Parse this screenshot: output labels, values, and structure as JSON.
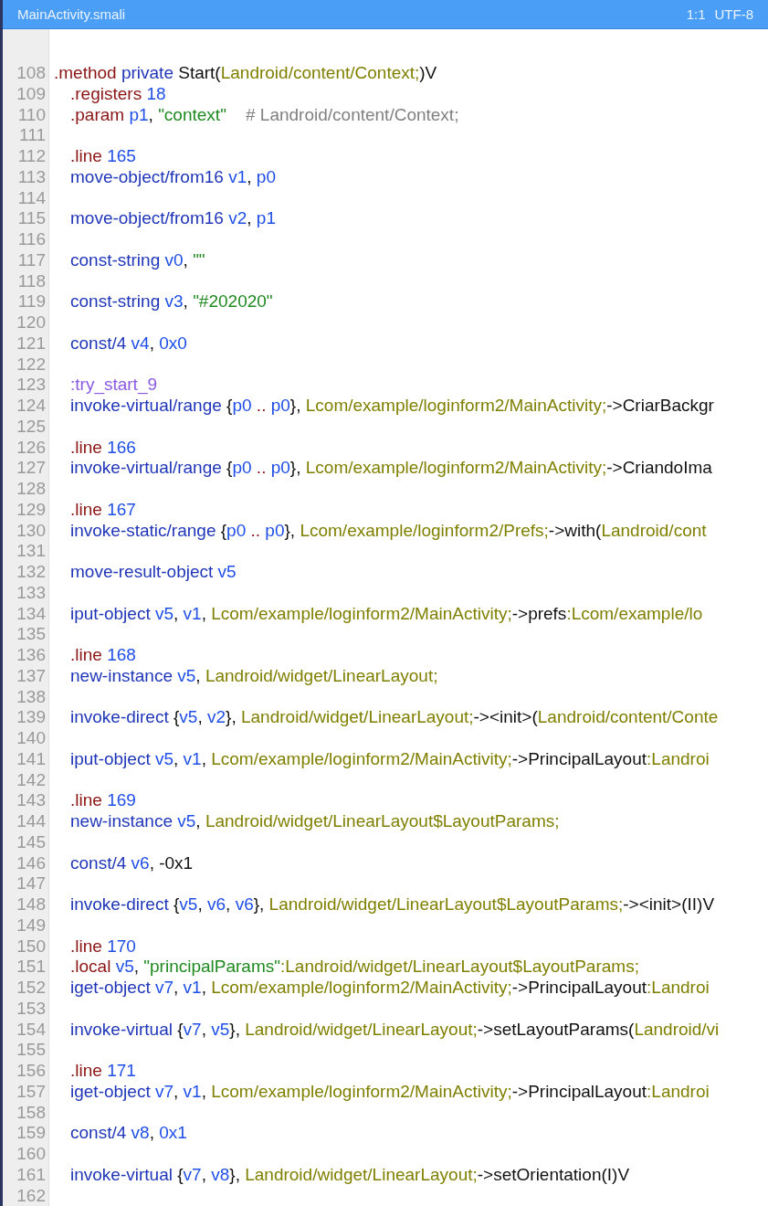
{
  "editor": {
    "file_name": "MainActivity.smali",
    "cursor_position": "1:1",
    "encoding": "UTF-8"
  },
  "lines": [
    {
      "number": "108",
      "kind": "header",
      "tokens": [
        {
          "text": ".method ",
          "kind": "directive"
        },
        {
          "text": "private",
          "kind": "op"
        },
        {
          "text": " Start(",
          "kind": "plain"
        },
        {
          "text": "Landroid/content/Context;",
          "kind": "type"
        },
        {
          "text": ")V",
          "kind": "plain"
        }
      ]
    },
    {
      "number": "109",
      "kind": "body",
      "tokens": [
        {
          "text": ".registers ",
          "kind": "directive"
        },
        {
          "text": "18",
          "kind": "number"
        }
      ]
    },
    {
      "number": "110",
      "kind": "body",
      "tokens": [
        {
          "text": ".param ",
          "kind": "directive"
        },
        {
          "text": "p1",
          "kind": "register"
        },
        {
          "text": ", ",
          "kind": "plain"
        },
        {
          "text": "\"context\"",
          "kind": "string"
        },
        {
          "text": "    # Landroid/content/Context;",
          "kind": "comment"
        }
      ]
    },
    {
      "number": "111"
    },
    {
      "number": "112",
      "kind": "body",
      "tokens": [
        {
          "text": ".line ",
          "kind": "directive"
        },
        {
          "text": "165",
          "kind": "number"
        }
      ]
    },
    {
      "number": "113",
      "kind": "body",
      "tokens": [
        {
          "text": "move-object/from16 ",
          "kind": "op"
        },
        {
          "text": "v1",
          "kind": "register"
        },
        {
          "text": ", ",
          "kind": "plain"
        },
        {
          "text": "p0",
          "kind": "register"
        }
      ]
    },
    {
      "number": "114"
    },
    {
      "number": "115",
      "kind": "body",
      "tokens": [
        {
          "text": "move-object/from16 ",
          "kind": "op"
        },
        {
          "text": "v2",
          "kind": "register"
        },
        {
          "text": ", ",
          "kind": "plain"
        },
        {
          "text": "p1",
          "kind": "register"
        }
      ]
    },
    {
      "number": "116"
    },
    {
      "number": "117",
      "kind": "body",
      "tokens": [
        {
          "text": "const-string ",
          "kind": "op"
        },
        {
          "text": "v0",
          "kind": "register"
        },
        {
          "text": ", ",
          "kind": "plain"
        },
        {
          "text": "\"\"",
          "kind": "string"
        }
      ]
    },
    {
      "number": "118"
    },
    {
      "number": "119",
      "kind": "body",
      "tokens": [
        {
          "text": "const-string ",
          "kind": "op"
        },
        {
          "text": "v3",
          "kind": "register"
        },
        {
          "text": ", ",
          "kind": "plain"
        },
        {
          "text": "\"#202020\"",
          "kind": "string"
        }
      ]
    },
    {
      "number": "120"
    },
    {
      "number": "121",
      "kind": "body",
      "tokens": [
        {
          "text": "const/4 ",
          "kind": "op"
        },
        {
          "text": "v4",
          "kind": "register"
        },
        {
          "text": ", ",
          "kind": "plain"
        },
        {
          "text": "0x0",
          "kind": "number"
        }
      ]
    },
    {
      "number": "122"
    },
    {
      "number": "123",
      "kind": "body",
      "tokens": [
        {
          "text": ":try_start_9",
          "kind": "label"
        }
      ]
    },
    {
      "number": "124",
      "kind": "body",
      "tokens": [
        {
          "text": "invoke-virtual/range",
          "kind": "op"
        },
        {
          "text": " {",
          "kind": "plain"
        },
        {
          "text": "p0",
          "kind": "register"
        },
        {
          "text": " .. ",
          "kind": "directive"
        },
        {
          "text": "p0",
          "kind": "register"
        },
        {
          "text": "}, ",
          "kind": "plain"
        },
        {
          "text": "Lcom/example/loginform2/MainActivity;",
          "kind": "type"
        },
        {
          "text": "->CriarBackgr",
          "kind": "plain"
        }
      ]
    },
    {
      "number": "125"
    },
    {
      "number": "126",
      "kind": "body",
      "tokens": [
        {
          "text": ".line ",
          "kind": "directive"
        },
        {
          "text": "166",
          "kind": "number"
        }
      ]
    },
    {
      "number": "127",
      "kind": "body",
      "tokens": [
        {
          "text": "invoke-virtual/range",
          "kind": "op"
        },
        {
          "text": " {",
          "kind": "plain"
        },
        {
          "text": "p0",
          "kind": "register"
        },
        {
          "text": " .. ",
          "kind": "directive"
        },
        {
          "text": "p0",
          "kind": "register"
        },
        {
          "text": "}, ",
          "kind": "plain"
        },
        {
          "text": "Lcom/example/loginform2/MainActivity;",
          "kind": "type"
        },
        {
          "text": "->CriandoIma",
          "kind": "plain"
        }
      ]
    },
    {
      "number": "128"
    },
    {
      "number": "129",
      "kind": "body",
      "tokens": [
        {
          "text": ".line ",
          "kind": "directive"
        },
        {
          "text": "167",
          "kind": "number"
        }
      ]
    },
    {
      "number": "130",
      "kind": "body",
      "tokens": [
        {
          "text": "invoke-static/range",
          "kind": "op"
        },
        {
          "text": " {",
          "kind": "plain"
        },
        {
          "text": "p0",
          "kind": "register"
        },
        {
          "text": " .. ",
          "kind": "directive"
        },
        {
          "text": "p0",
          "kind": "register"
        },
        {
          "text": "}, ",
          "kind": "plain"
        },
        {
          "text": "Lcom/example/loginform2/Prefs;",
          "kind": "type"
        },
        {
          "text": "->with(",
          "kind": "plain"
        },
        {
          "text": "Landroid/cont",
          "kind": "type"
        }
      ]
    },
    {
      "number": "131"
    },
    {
      "number": "132",
      "kind": "body",
      "tokens": [
        {
          "text": "move-result-object ",
          "kind": "op"
        },
        {
          "text": "v5",
          "kind": "register"
        }
      ]
    },
    {
      "number": "133"
    },
    {
      "number": "134",
      "kind": "body",
      "tokens": [
        {
          "text": "iput-object ",
          "kind": "op"
        },
        {
          "text": "v5",
          "kind": "register"
        },
        {
          "text": ", ",
          "kind": "plain"
        },
        {
          "text": "v1",
          "kind": "register"
        },
        {
          "text": ", ",
          "kind": "plain"
        },
        {
          "text": "Lcom/example/loginform2/MainActivity;",
          "kind": "type"
        },
        {
          "text": "->prefs",
          "kind": "plain"
        },
        {
          "text": ":Lcom/example/lo",
          "kind": "type"
        }
      ]
    },
    {
      "number": "135"
    },
    {
      "number": "136",
      "kind": "body",
      "tokens": [
        {
          "text": ".line ",
          "kind": "directive"
        },
        {
          "text": "168",
          "kind": "number"
        }
      ]
    },
    {
      "number": "137",
      "kind": "body",
      "tokens": [
        {
          "text": "new-instance ",
          "kind": "op"
        },
        {
          "text": "v5",
          "kind": "register"
        },
        {
          "text": ", ",
          "kind": "plain"
        },
        {
          "text": "Landroid/widget/LinearLayout;",
          "kind": "type"
        }
      ]
    },
    {
      "number": "138"
    },
    {
      "number": "139",
      "kind": "body",
      "tokens": [
        {
          "text": "invoke-direct",
          "kind": "op"
        },
        {
          "text": " {",
          "kind": "plain"
        },
        {
          "text": "v5",
          "kind": "register"
        },
        {
          "text": ", ",
          "kind": "plain"
        },
        {
          "text": "v2",
          "kind": "register"
        },
        {
          "text": "}, ",
          "kind": "plain"
        },
        {
          "text": "Landroid/widget/LinearLayout;",
          "kind": "type"
        },
        {
          "text": "-><init>(",
          "kind": "plain"
        },
        {
          "text": "Landroid/content/Conte",
          "kind": "type"
        }
      ]
    },
    {
      "number": "140"
    },
    {
      "number": "141",
      "kind": "body",
      "tokens": [
        {
          "text": "iput-object ",
          "kind": "op"
        },
        {
          "text": "v5",
          "kind": "register"
        },
        {
          "text": ", ",
          "kind": "plain"
        },
        {
          "text": "v1",
          "kind": "register"
        },
        {
          "text": ", ",
          "kind": "plain"
        },
        {
          "text": "Lcom/example/loginform2/MainActivity;",
          "kind": "type"
        },
        {
          "text": "->PrincipalLayout",
          "kind": "plain"
        },
        {
          "text": ":Landroi",
          "kind": "type"
        }
      ]
    },
    {
      "number": "142"
    },
    {
      "number": "143",
      "kind": "body",
      "tokens": [
        {
          "text": ".line ",
          "kind": "directive"
        },
        {
          "text": "169",
          "kind": "number"
        }
      ]
    },
    {
      "number": "144",
      "kind": "body",
      "tokens": [
        {
          "text": "new-instance ",
          "kind": "op"
        },
        {
          "text": "v5",
          "kind": "register"
        },
        {
          "text": ", ",
          "kind": "plain"
        },
        {
          "text": "Landroid/widget/LinearLayout$LayoutParams;",
          "kind": "type"
        }
      ]
    },
    {
      "number": "145"
    },
    {
      "number": "146",
      "kind": "body",
      "tokens": [
        {
          "text": "const/4 ",
          "kind": "op"
        },
        {
          "text": "v6",
          "kind": "register"
        },
        {
          "text": ", -0x1",
          "kind": "plain"
        }
      ]
    },
    {
      "number": "147"
    },
    {
      "number": "148",
      "kind": "body",
      "tokens": [
        {
          "text": "invoke-direct",
          "kind": "op"
        },
        {
          "text": " {",
          "kind": "plain"
        },
        {
          "text": "v5",
          "kind": "register"
        },
        {
          "text": ", ",
          "kind": "plain"
        },
        {
          "text": "v6",
          "kind": "register"
        },
        {
          "text": ", ",
          "kind": "plain"
        },
        {
          "text": "v6",
          "kind": "register"
        },
        {
          "text": "}, ",
          "kind": "plain"
        },
        {
          "text": "Landroid/widget/LinearLayout$LayoutParams;",
          "kind": "type"
        },
        {
          "text": "-><init>(II)V",
          "kind": "plain"
        }
      ]
    },
    {
      "number": "149"
    },
    {
      "number": "150",
      "kind": "body",
      "tokens": [
        {
          "text": ".line ",
          "kind": "directive"
        },
        {
          "text": "170",
          "kind": "number"
        }
      ]
    },
    {
      "number": "151",
      "kind": "body",
      "tokens": [
        {
          "text": ".local ",
          "kind": "directive"
        },
        {
          "text": "v5",
          "kind": "register"
        },
        {
          "text": ", ",
          "kind": "plain"
        },
        {
          "text": "\"principalParams\"",
          "kind": "string"
        },
        {
          "text": ":Landroid/widget/LinearLayout$LayoutParams;",
          "kind": "type"
        }
      ]
    },
    {
      "number": "152",
      "kind": "body",
      "tokens": [
        {
          "text": "iget-object ",
          "kind": "op"
        },
        {
          "text": "v7",
          "kind": "register"
        },
        {
          "text": ", ",
          "kind": "plain"
        },
        {
          "text": "v1",
          "kind": "register"
        },
        {
          "text": ", ",
          "kind": "plain"
        },
        {
          "text": "Lcom/example/loginform2/MainActivity;",
          "kind": "type"
        },
        {
          "text": "->PrincipalLayout",
          "kind": "plain"
        },
        {
          "text": ":Landroi",
          "kind": "type"
        }
      ]
    },
    {
      "number": "153"
    },
    {
      "number": "154",
      "kind": "body",
      "tokens": [
        {
          "text": "invoke-virtual",
          "kind": "op"
        },
        {
          "text": " {",
          "kind": "plain"
        },
        {
          "text": "v7",
          "kind": "register"
        },
        {
          "text": ", ",
          "kind": "plain"
        },
        {
          "text": "v5",
          "kind": "register"
        },
        {
          "text": "}, ",
          "kind": "plain"
        },
        {
          "text": "Landroid/widget/LinearLayout;",
          "kind": "type"
        },
        {
          "text": "->setLayoutParams(",
          "kind": "plain"
        },
        {
          "text": "Landroid/vi",
          "kind": "type"
        }
      ]
    },
    {
      "number": "155"
    },
    {
      "number": "156",
      "kind": "body",
      "tokens": [
        {
          "text": ".line ",
          "kind": "directive"
        },
        {
          "text": "171",
          "kind": "number"
        }
      ]
    },
    {
      "number": "157",
      "kind": "body",
      "tokens": [
        {
          "text": "iget-object ",
          "kind": "op"
        },
        {
          "text": "v7",
          "kind": "register"
        },
        {
          "text": ", ",
          "kind": "plain"
        },
        {
          "text": "v1",
          "kind": "register"
        },
        {
          "text": ", ",
          "kind": "plain"
        },
        {
          "text": "Lcom/example/loginform2/MainActivity;",
          "kind": "type"
        },
        {
          "text": "->PrincipalLayout",
          "kind": "plain"
        },
        {
          "text": ":Landroi",
          "kind": "type"
        }
      ]
    },
    {
      "number": "158"
    },
    {
      "number": "159",
      "kind": "body",
      "tokens": [
        {
          "text": "const/4 ",
          "kind": "op"
        },
        {
          "text": "v8",
          "kind": "register"
        },
        {
          "text": ", ",
          "kind": "plain"
        },
        {
          "text": "0x1",
          "kind": "number"
        }
      ]
    },
    {
      "number": "160"
    },
    {
      "number": "161",
      "kind": "body",
      "tokens": [
        {
          "text": "invoke-virtual",
          "kind": "op"
        },
        {
          "text": " {",
          "kind": "plain"
        },
        {
          "text": "v7",
          "kind": "register"
        },
        {
          "text": ", ",
          "kind": "plain"
        },
        {
          "text": "v8",
          "kind": "register"
        },
        {
          "text": "}, ",
          "kind": "plain"
        },
        {
          "text": "Landroid/widget/LinearLayout;",
          "kind": "type"
        },
        {
          "text": "->setOrientation(I)V",
          "kind": "plain"
        }
      ]
    },
    {
      "number": "162"
    }
  ]
}
